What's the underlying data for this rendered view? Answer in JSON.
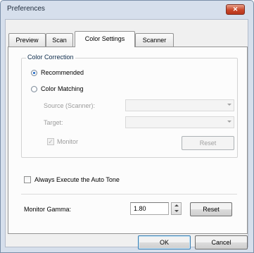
{
  "window": {
    "title": "Preferences",
    "close_glyph": "✕"
  },
  "tabs": [
    {
      "label": "Preview",
      "active": false
    },
    {
      "label": "Scan",
      "active": false
    },
    {
      "label": "Color Settings",
      "active": true
    },
    {
      "label": "Scanner",
      "active": false
    }
  ],
  "color_correction": {
    "legend": "Color Correction",
    "recommended_label": "Recommended",
    "recommended_checked": true,
    "color_matching_label": "Color Matching",
    "color_matching_checked": false,
    "source_label": "Source (Scanner):",
    "source_value": "",
    "target_label": "Target:",
    "target_value": "",
    "monitor_label": "Monitor",
    "monitor_checked": true,
    "reset_label": "Reset"
  },
  "auto_tone": {
    "label": "Always Execute the Auto Tone",
    "checked": false
  },
  "monitor_gamma": {
    "label": "Monitor Gamma:",
    "value": "1.80",
    "reset_label": "Reset"
  },
  "footer": {
    "ok_label": "OK",
    "cancel_label": "Cancel"
  },
  "icons": {
    "close": "close-icon",
    "combo_arrow": "chevron-down-icon",
    "spin_up": "spin-up-icon",
    "spin_down": "spin-down-icon",
    "check": "checkmark-icon"
  },
  "colors": {
    "titlebar": "#d6dfec",
    "close_button": "#c9472a",
    "radio_selected": "#2a6fc9",
    "default_button_border": "#3c7fb1"
  }
}
